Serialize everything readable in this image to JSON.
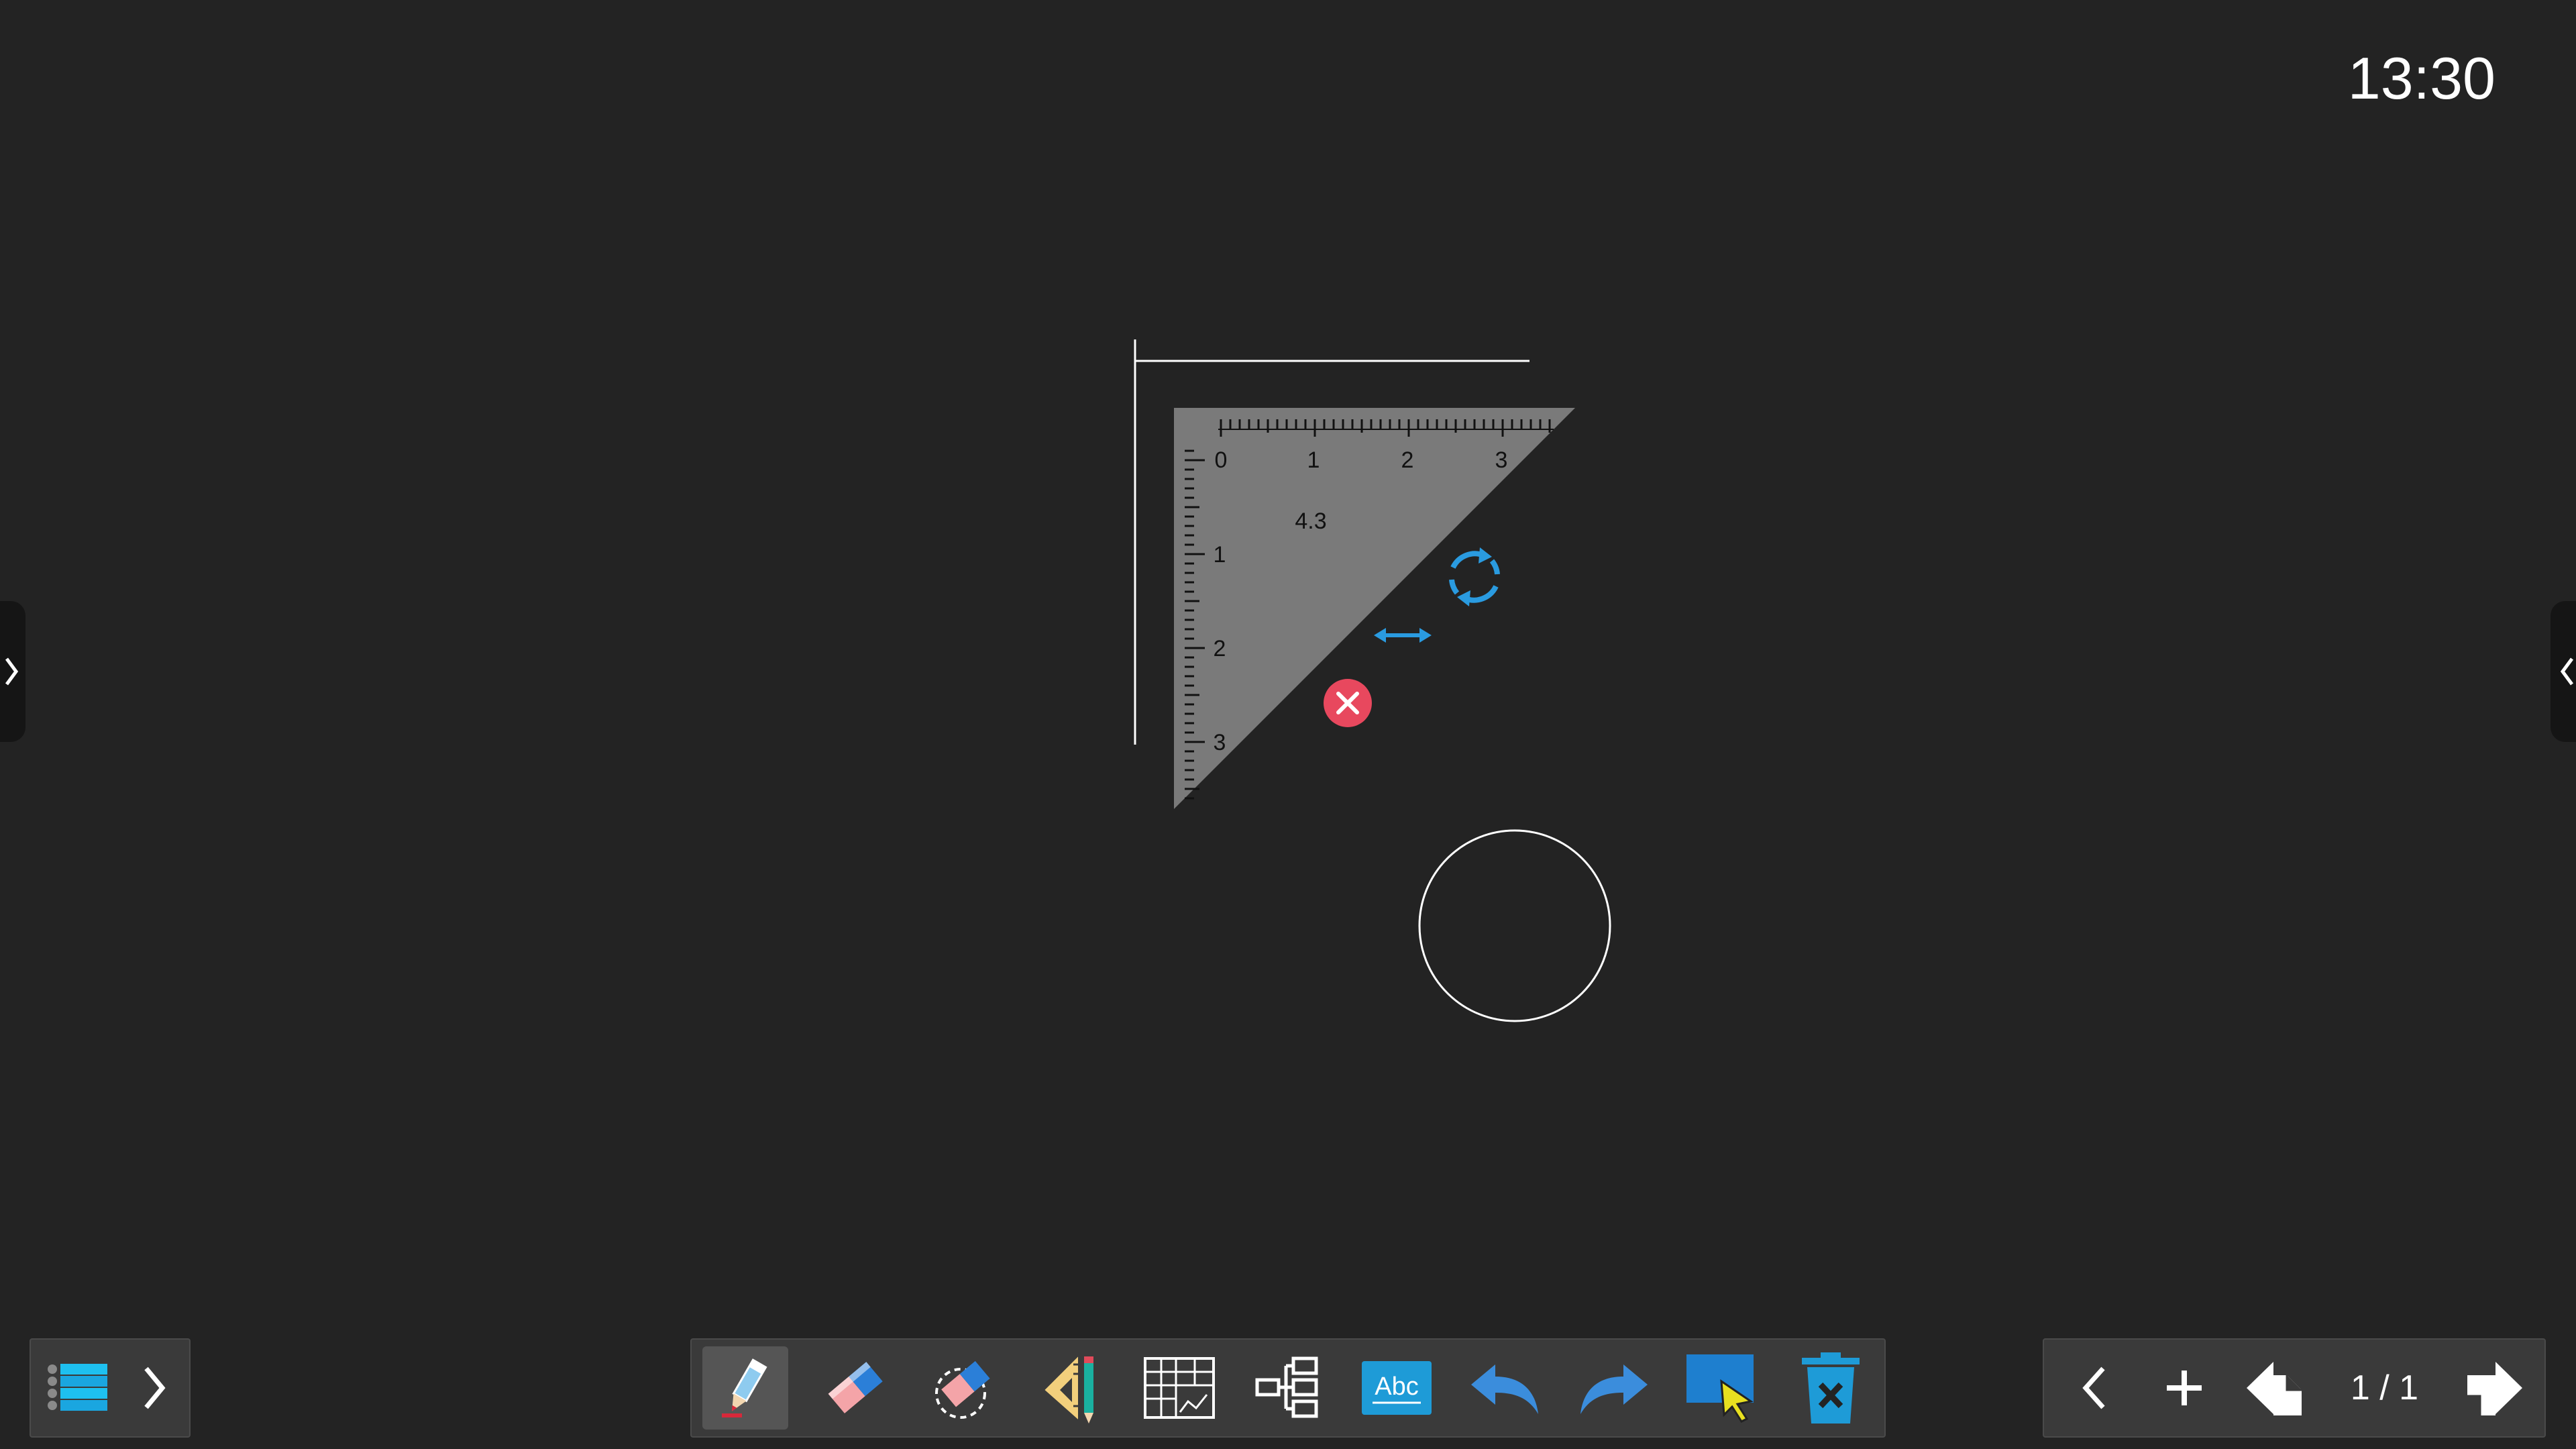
{
  "status": {
    "clock": "13:30"
  },
  "set_square": {
    "top_scale_labels": [
      "0",
      "1",
      "2",
      "3"
    ],
    "left_scale_labels": [
      "1",
      "2",
      "3"
    ],
    "measurement": "4.3",
    "close_color": "#e8485e",
    "handle_color": "#2a9be0"
  },
  "toolbar": {
    "tools": [
      {
        "name": "pen-tool",
        "icon": "pencil-icon",
        "active": true
      },
      {
        "name": "eraser-tool",
        "icon": "eraser-icon",
        "active": false
      },
      {
        "name": "lasso-eraser-tool",
        "icon": "lasso-eraser-icon",
        "active": false
      },
      {
        "name": "geometry-tool",
        "icon": "ruler-pencil-icon",
        "active": false
      },
      {
        "name": "table-tool",
        "icon": "table-chart-icon",
        "active": false
      },
      {
        "name": "mindmap-tool",
        "icon": "mindmap-icon",
        "active": false
      },
      {
        "name": "text-tool",
        "icon": "abc-text-icon",
        "label": "Abc",
        "active": false
      },
      {
        "name": "undo-tool",
        "icon": "undo-icon",
        "active": false
      },
      {
        "name": "redo-tool",
        "icon": "redo-icon",
        "active": false
      },
      {
        "name": "select-tool",
        "icon": "select-cursor-icon",
        "active": false
      },
      {
        "name": "clear-tool",
        "icon": "trash-icon",
        "active": false
      }
    ]
  },
  "pager": {
    "indicator": "1 / 1"
  },
  "colors": {
    "background": "#232323",
    "panel": "#3a3a3a",
    "accent": "#1e9bd7"
  }
}
